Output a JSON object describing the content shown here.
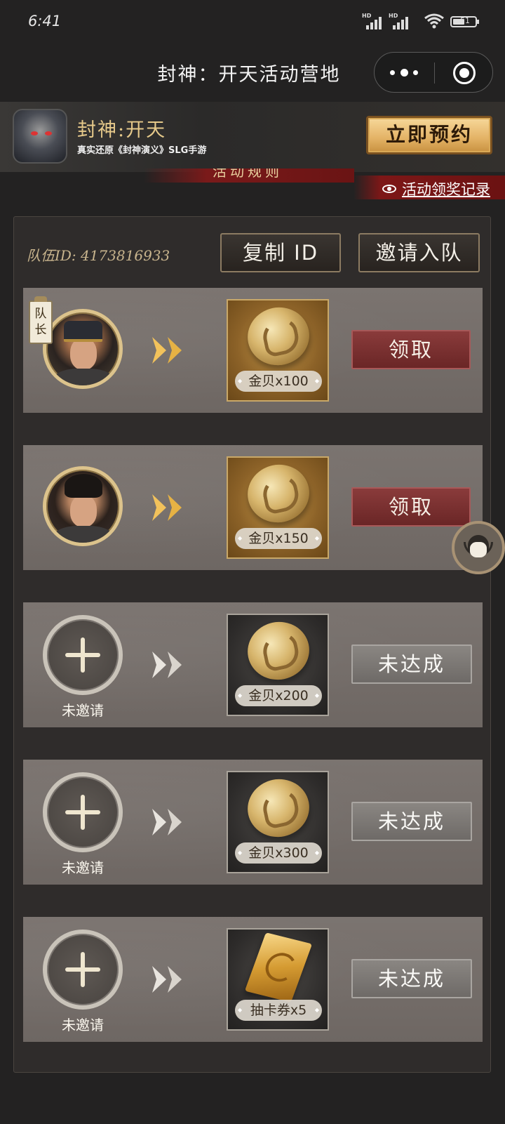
{
  "status_bar": {
    "time": "6:41",
    "signal1_label": "HD",
    "signal2_label": "HD",
    "battery": "51"
  },
  "nav": {
    "title": "封神：开天活动营地",
    "more_icon": "more-dots-icon",
    "close_icon": "target-icon"
  },
  "banner": {
    "game_title": "封神:开天",
    "subtitle": "真实还原《封神演义》SLG手游",
    "preorder_label": "立即预约"
  },
  "links": {
    "rules": "活动规则",
    "records": "活动领奖记录"
  },
  "team": {
    "id_text": "队伍ID: 4173816933",
    "copy_label": "复制 ID",
    "invite_label": "邀请入队"
  },
  "rows": [
    {
      "member": "captain",
      "captain_tag": "队长",
      "reward": "金贝x100",
      "action": "领取",
      "state": "claimable"
    },
    {
      "member": "member",
      "reward": "金贝x150",
      "action": "领取",
      "state": "claimable"
    },
    {
      "member": "empty",
      "member_label": "未邀请",
      "reward": "金贝x200",
      "action": "未达成",
      "state": "locked"
    },
    {
      "member": "empty",
      "member_label": "未邀请",
      "reward": "金贝x300",
      "action": "未达成",
      "state": "locked"
    },
    {
      "member": "empty",
      "member_label": "未邀请",
      "reward": "抽卡券x5",
      "action": "未达成",
      "state": "locked"
    }
  ],
  "colors": {
    "accent_gold": "#e6c98a",
    "claim_red": "#7a2f2f",
    "panel": "#2f2c2b"
  }
}
